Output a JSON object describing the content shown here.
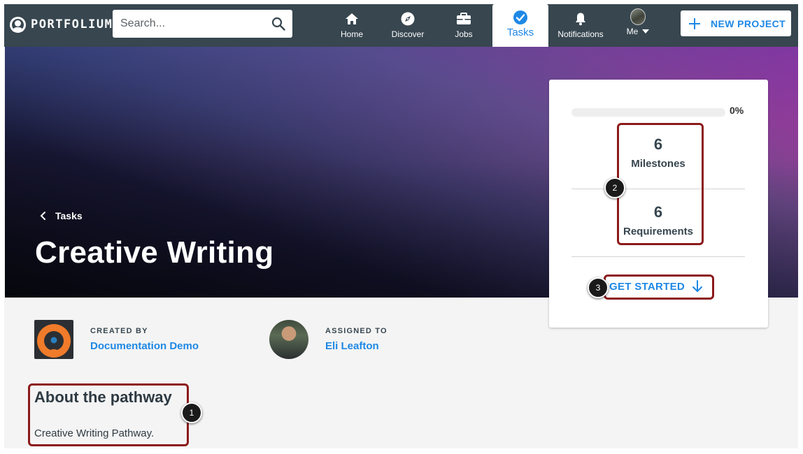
{
  "app": {
    "name": "PORTFOLIUM"
  },
  "search": {
    "placeholder": "Search..."
  },
  "nav": {
    "home": "Home",
    "discover": "Discover",
    "jobs": "Jobs",
    "tasks": "Tasks",
    "notifications": "Notifications",
    "me": "Me",
    "new_project": "NEW PROJECT"
  },
  "hero": {
    "back_label": "Tasks",
    "title": "Creative Writing"
  },
  "stats": {
    "progress_fraction": 0,
    "progress_label": "0%",
    "milestones_count": "6",
    "milestones_label": "Milestones",
    "requirements_count": "6",
    "requirements_label": "Requirements",
    "cta_label": "GET STARTED"
  },
  "meta": {
    "created_by_label": "CREATED BY",
    "created_by_value": "Documentation Demo",
    "assigned_to_label": "ASSIGNED TO",
    "assigned_to_value": "Eli Leafton"
  },
  "about": {
    "title": "About the pathway",
    "body": "Creative Writing Pathway."
  },
  "annotations": [
    "1",
    "2",
    "3"
  ],
  "colors": {
    "navbar": "#37464f",
    "accent": "#1e88e5",
    "annotation": "#8c1a1a"
  }
}
